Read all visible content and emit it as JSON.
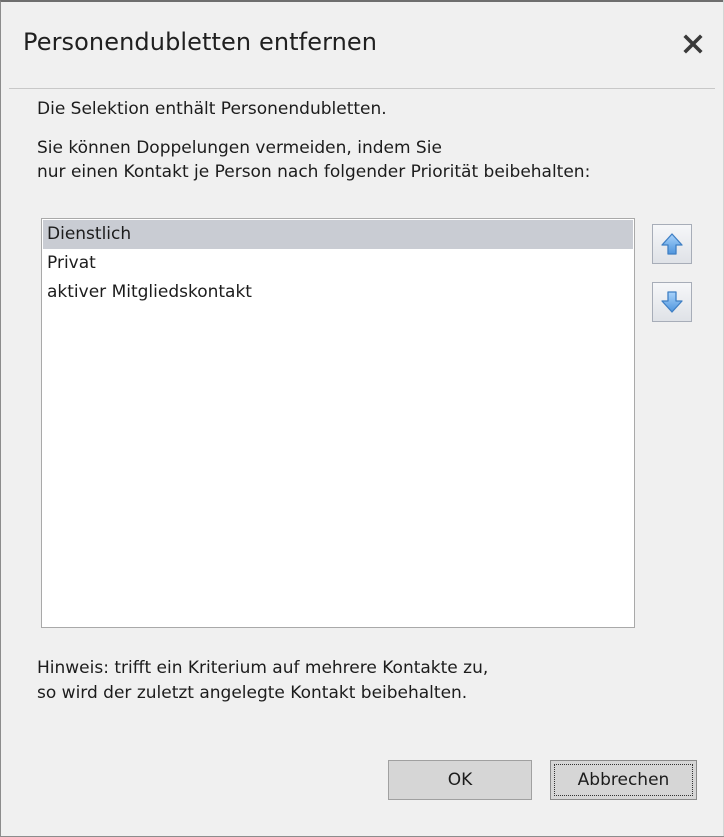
{
  "dialog": {
    "title": "Personendubletten entfernen",
    "close_icon": "close-icon",
    "info_line": "Die Selektion enthält Personendubletten.",
    "instruction_line1": "Sie können Doppelungen vermeiden, indem Sie",
    "instruction_line2": "nur einen Kontakt je Person nach folgender Priorität beibehalten:",
    "priority_list": {
      "items": [
        {
          "label": "Dienstlich",
          "selected": true
        },
        {
          "label": "Privat",
          "selected": false
        },
        {
          "label": "aktiver Mitgliedskontakt",
          "selected": false
        }
      ]
    },
    "move_up_icon": "arrow-up-icon",
    "move_down_icon": "arrow-down-icon",
    "note_line1": "Hinweis: trifft ein Kriterium auf mehrere Kontakte zu,",
    "note_line2": "so wird der zuletzt angelegte Kontakt beibehalten.",
    "ok_label": "OK",
    "cancel_label": "Abbrechen"
  },
  "colors": {
    "background": "#f0f0f0",
    "selected_item": "#c9ccd3",
    "arrow_icon": "#6aa7e8"
  }
}
